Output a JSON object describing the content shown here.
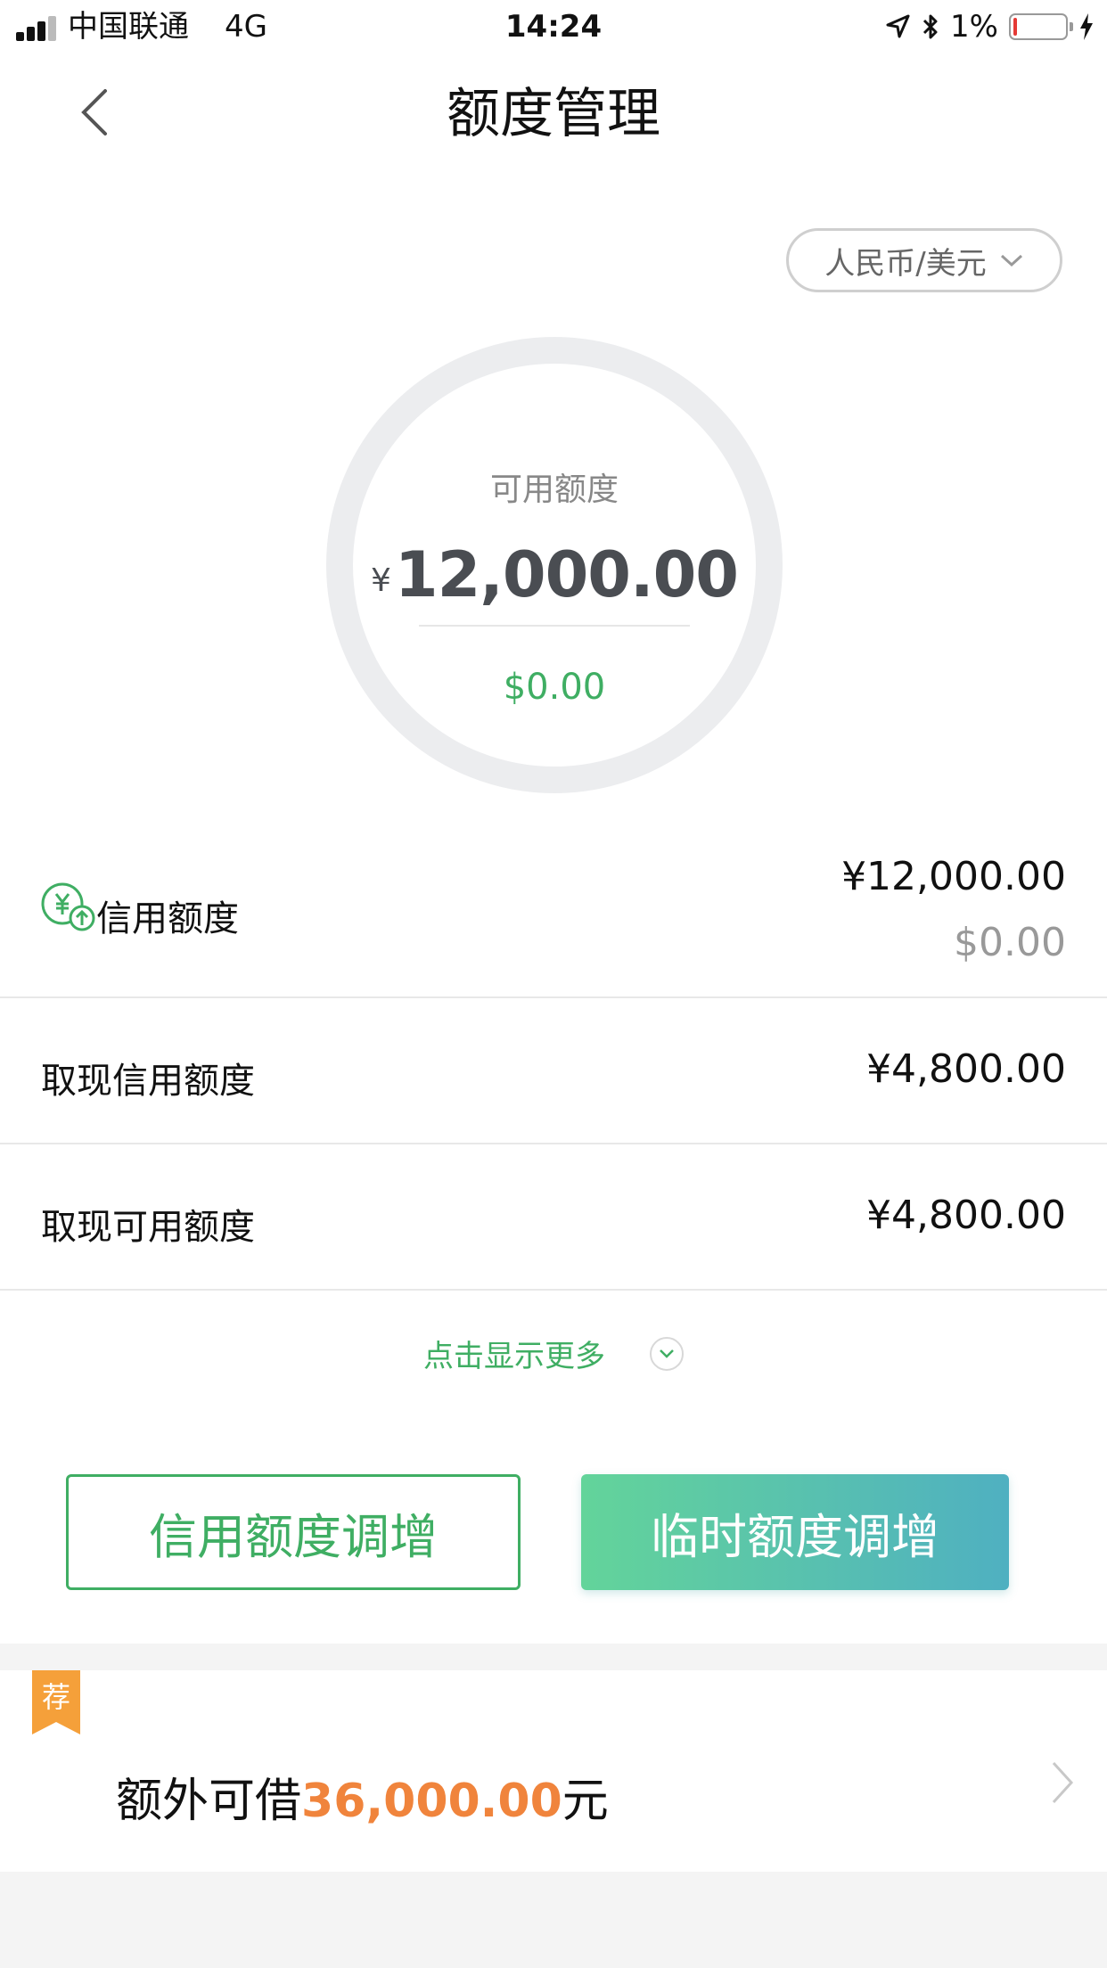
{
  "status_bar": {
    "carrier": "中国联通",
    "network": "4G",
    "time": "14:24",
    "battery_percent": "1%",
    "battery_level": 0.01
  },
  "nav": {
    "title": "额度管理"
  },
  "currency_toggle": {
    "label": "人民币/美元"
  },
  "available": {
    "label": "可用额度",
    "currency_symbol": "¥",
    "amount": "12,000.00",
    "usd": "$0.00"
  },
  "rows": [
    {
      "label": "信用额度",
      "value": "¥12,000.00",
      "sub_value": "$0.00",
      "icon": "yuan-up-icon"
    },
    {
      "label": "取现信用额度",
      "value": "¥4,800.00"
    },
    {
      "label": "取现可用额度",
      "value": "¥4,800.00"
    }
  ],
  "show_more": {
    "label": "点击显示更多"
  },
  "buttons": {
    "increase_credit": "信用额度调增",
    "temporary_increase": "临时额度调增"
  },
  "promo": {
    "badge": "荐",
    "prefix": "额外可借",
    "amount": "36,000.00",
    "suffix": "元"
  },
  "colors": {
    "accent_green": "#3fae63",
    "promo_orange": "#f0843c",
    "ribbon_orange": "#f5a03a",
    "gradient_start": "#63d49a",
    "gradient_end": "#4fb0c1"
  }
}
